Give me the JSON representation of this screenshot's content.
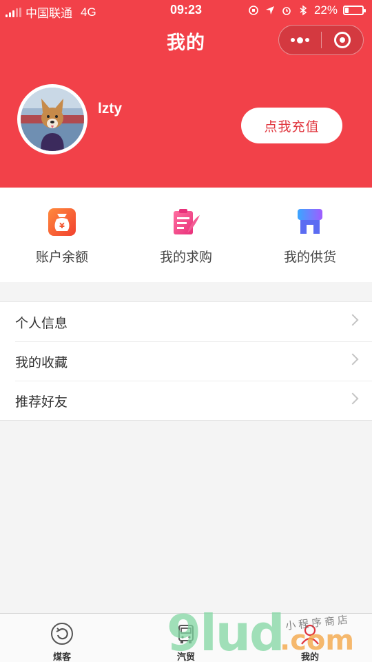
{
  "status_bar": {
    "carrier": "中国联通",
    "network": "4G",
    "time": "09:23",
    "battery": "22%",
    "battery_level": 0.22
  },
  "nav": {
    "title": "我的"
  },
  "profile": {
    "username": "lzty",
    "recharge_label": "点我充值"
  },
  "quick_actions": [
    {
      "label": "账户余额",
      "icon": "money-bag-icon"
    },
    {
      "label": "我的求购",
      "icon": "purchase-note-icon"
    },
    {
      "label": "我的供货",
      "icon": "shop-icon"
    }
  ],
  "menu": [
    {
      "label": "个人信息"
    },
    {
      "label": "我的收藏"
    },
    {
      "label": "推荐好友"
    }
  ],
  "tabbar": [
    {
      "label": "煤客",
      "icon": "refresh-circle-icon"
    },
    {
      "label": "汽贸",
      "icon": "truck-icon"
    },
    {
      "label": "我的",
      "icon": "person-icon"
    }
  ],
  "watermark": {
    "brand": "9lud",
    "domain": ".com",
    "tagline": "小程序商店"
  },
  "colors": {
    "accent": "#f24149",
    "background": "#f4f4f4"
  }
}
